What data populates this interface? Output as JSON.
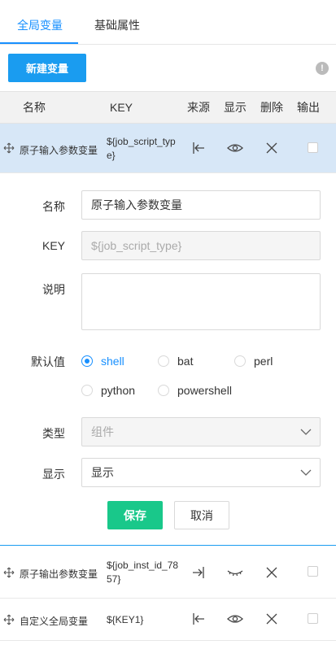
{
  "tabs": [
    {
      "label": "全局变量",
      "active": true
    },
    {
      "label": "基础属性",
      "active": false
    }
  ],
  "toolbar": {
    "new_button_label": "新建变量",
    "info_icon": "info-icon",
    "info_glyph": "!"
  },
  "table": {
    "headers": {
      "name": "名称",
      "key": "KEY",
      "source": "来源",
      "visible": "显示",
      "delete": "删除",
      "output": "输出"
    },
    "rows": [
      {
        "name": "原子输入参数变量",
        "key": "${job_script_type}",
        "source_icon": "input-arrow-icon",
        "visible_icon": "eye-open-icon",
        "delete_icon": "close-icon",
        "output": false,
        "selected": true
      },
      {
        "name": "原子输出参数变量",
        "key": "${job_inst_id_7857}",
        "source_icon": "output-arrow-icon",
        "visible_icon": "eye-closed-icon",
        "delete_icon": "close-icon",
        "output": false,
        "selected": false
      },
      {
        "name": "自定义全局变量",
        "key": "${KEY1}",
        "source_icon": "input-arrow-icon",
        "visible_icon": "eye-open-icon",
        "delete_icon": "close-icon",
        "output": false,
        "selected": false
      }
    ]
  },
  "form": {
    "name_label": "名称",
    "name_value": "原子输入参数变量",
    "key_label": "KEY",
    "key_value": "${job_script_type}",
    "desc_label": "说明",
    "desc_value": "",
    "default_label": "默认值",
    "default_options": [
      "shell",
      "bat",
      "perl",
      "python",
      "powershell"
    ],
    "default_selected": "shell",
    "type_label": "类型",
    "type_value": "组件",
    "display_label": "显示",
    "display_value": "显示",
    "save_label": "保存",
    "cancel_label": "取消"
  },
  "colors": {
    "accent": "#1890ff",
    "primary_button": "#1a9cf0",
    "save_button": "#19c88a",
    "selected_row": "#d7e7f7"
  }
}
